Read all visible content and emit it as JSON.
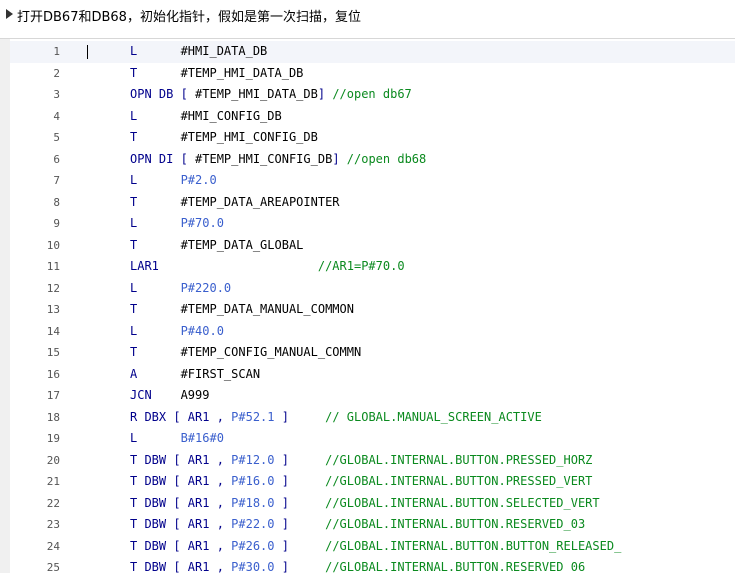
{
  "header": {
    "title": "打开DB67和DB68，初始化指针，假如是第一次扫描，复位"
  },
  "editor": {
    "lines": [
      {
        "n": "1",
        "tokens": [
          {
            "t": "L",
            "c": "op"
          },
          {
            "t": "      #HMI_DATA_DB",
            "c": "sym"
          }
        ]
      },
      {
        "n": "2",
        "tokens": [
          {
            "t": "T",
            "c": "op"
          },
          {
            "t": "      #TEMP_HMI_DATA_DB",
            "c": "sym"
          }
        ]
      },
      {
        "n": "3",
        "tokens": [
          {
            "t": "OPN DB [ ",
            "c": "op"
          },
          {
            "t": "#TEMP_HMI_DATA_DB",
            "c": "sym"
          },
          {
            "t": "] ",
            "c": "op"
          },
          {
            "t": "//open db67",
            "c": "cmt"
          }
        ]
      },
      {
        "n": "4",
        "tokens": [
          {
            "t": "L",
            "c": "op"
          },
          {
            "t": "      #HMI_CONFIG_DB",
            "c": "sym"
          }
        ]
      },
      {
        "n": "5",
        "tokens": [
          {
            "t": "T",
            "c": "op"
          },
          {
            "t": "      #TEMP_HMI_CONFIG_DB",
            "c": "sym"
          }
        ]
      },
      {
        "n": "6",
        "tokens": [
          {
            "t": "OPN DI [ ",
            "c": "op"
          },
          {
            "t": "#TEMP_HMI_CONFIG_DB",
            "c": "sym"
          },
          {
            "t": "] ",
            "c": "op"
          },
          {
            "t": "//open db68",
            "c": "cmt"
          }
        ]
      },
      {
        "n": "7",
        "tokens": [
          {
            "t": "L",
            "c": "op"
          },
          {
            "t": "      P#2.0",
            "c": "lit"
          }
        ]
      },
      {
        "n": "8",
        "tokens": [
          {
            "t": "T",
            "c": "op"
          },
          {
            "t": "      #TEMP_DATA_AREAPOINTER",
            "c": "sym"
          }
        ]
      },
      {
        "n": "9",
        "tokens": [
          {
            "t": "L",
            "c": "op"
          },
          {
            "t": "      P#70.0",
            "c": "lit"
          }
        ]
      },
      {
        "n": "10",
        "tokens": [
          {
            "t": "T",
            "c": "op"
          },
          {
            "t": "      #TEMP_DATA_GLOBAL",
            "c": "sym"
          }
        ]
      },
      {
        "n": "11",
        "tokens": [
          {
            "t": "LAR1",
            "c": "op"
          },
          {
            "t": "                      //AR1=P#70.0",
            "c": "cmt"
          }
        ]
      },
      {
        "n": "12",
        "tokens": [
          {
            "t": "L",
            "c": "op"
          },
          {
            "t": "      P#220.0",
            "c": "lit"
          }
        ]
      },
      {
        "n": "13",
        "tokens": [
          {
            "t": "T",
            "c": "op"
          },
          {
            "t": "      #TEMP_DATA_MANUAL_COMMON",
            "c": "sym"
          }
        ]
      },
      {
        "n": "14",
        "tokens": [
          {
            "t": "L",
            "c": "op"
          },
          {
            "t": "      P#40.0",
            "c": "lit"
          }
        ]
      },
      {
        "n": "15",
        "tokens": [
          {
            "t": "T",
            "c": "op"
          },
          {
            "t": "      #TEMP_CONFIG_MANUAL_COMMN",
            "c": "sym"
          }
        ]
      },
      {
        "n": "16",
        "tokens": [
          {
            "t": "A",
            "c": "op"
          },
          {
            "t": "      #FIRST_SCAN",
            "c": "sym"
          }
        ]
      },
      {
        "n": "17",
        "tokens": [
          {
            "t": "JCN",
            "c": "op"
          },
          {
            "t": "    A999",
            "c": "sym"
          }
        ]
      },
      {
        "n": "18",
        "tokens": [
          {
            "t": "R DBX [ AR1 , ",
            "c": "op"
          },
          {
            "t": "P#52.1",
            "c": "lit"
          },
          {
            "t": " ]",
            "c": "op"
          },
          {
            "t": "     // GLOBAL.MANUAL_SCREEN_ACTIVE",
            "c": "cmt"
          }
        ]
      },
      {
        "n": "19",
        "tokens": [
          {
            "t": "L",
            "c": "op"
          },
          {
            "t": "      B#16#0",
            "c": "lit"
          }
        ]
      },
      {
        "n": "20",
        "tokens": [
          {
            "t": "T DBW [ AR1 , ",
            "c": "op"
          },
          {
            "t": "P#12.0",
            "c": "lit"
          },
          {
            "t": " ]",
            "c": "op"
          },
          {
            "t": "     //GLOBAL.INTERNAL.BUTTON.PRESSED_HORZ",
            "c": "cmt"
          }
        ]
      },
      {
        "n": "21",
        "tokens": [
          {
            "t": "T DBW [ AR1 , ",
            "c": "op"
          },
          {
            "t": "P#16.0",
            "c": "lit"
          },
          {
            "t": " ]",
            "c": "op"
          },
          {
            "t": "     //GLOBAL.INTERNAL.BUTTON.PRESSED_VERT",
            "c": "cmt"
          }
        ]
      },
      {
        "n": "22",
        "tokens": [
          {
            "t": "T DBW [ AR1 , ",
            "c": "op"
          },
          {
            "t": "P#18.0",
            "c": "lit"
          },
          {
            "t": " ]",
            "c": "op"
          },
          {
            "t": "     //GLOBAL.INTERNAL.BUTTON.SELECTED_VERT",
            "c": "cmt"
          }
        ]
      },
      {
        "n": "23",
        "tokens": [
          {
            "t": "T DBW [ AR1 , ",
            "c": "op"
          },
          {
            "t": "P#22.0",
            "c": "lit"
          },
          {
            "t": " ]",
            "c": "op"
          },
          {
            "t": "     //GLOBAL.INTERNAL.BUTTON.RESERVED_03",
            "c": "cmt"
          }
        ]
      },
      {
        "n": "24",
        "tokens": [
          {
            "t": "T DBW [ AR1 , ",
            "c": "op"
          },
          {
            "t": "P#26.0",
            "c": "lit"
          },
          {
            "t": " ]",
            "c": "op"
          },
          {
            "t": "     //GLOBAL.INTERNAL.BUTTON.BUTTON_RELEASED_",
            "c": "cmt"
          }
        ]
      },
      {
        "n": "25",
        "tokens": [
          {
            "t": "T DBW [ AR1 , ",
            "c": "op"
          },
          {
            "t": "P#30.0",
            "c": "lit"
          },
          {
            "t": " ]",
            "c": "op"
          },
          {
            "t": "     //GLOBAL.INTERNAL.BUTTON.RESERVED_06",
            "c": "cmt"
          }
        ]
      }
    ]
  }
}
